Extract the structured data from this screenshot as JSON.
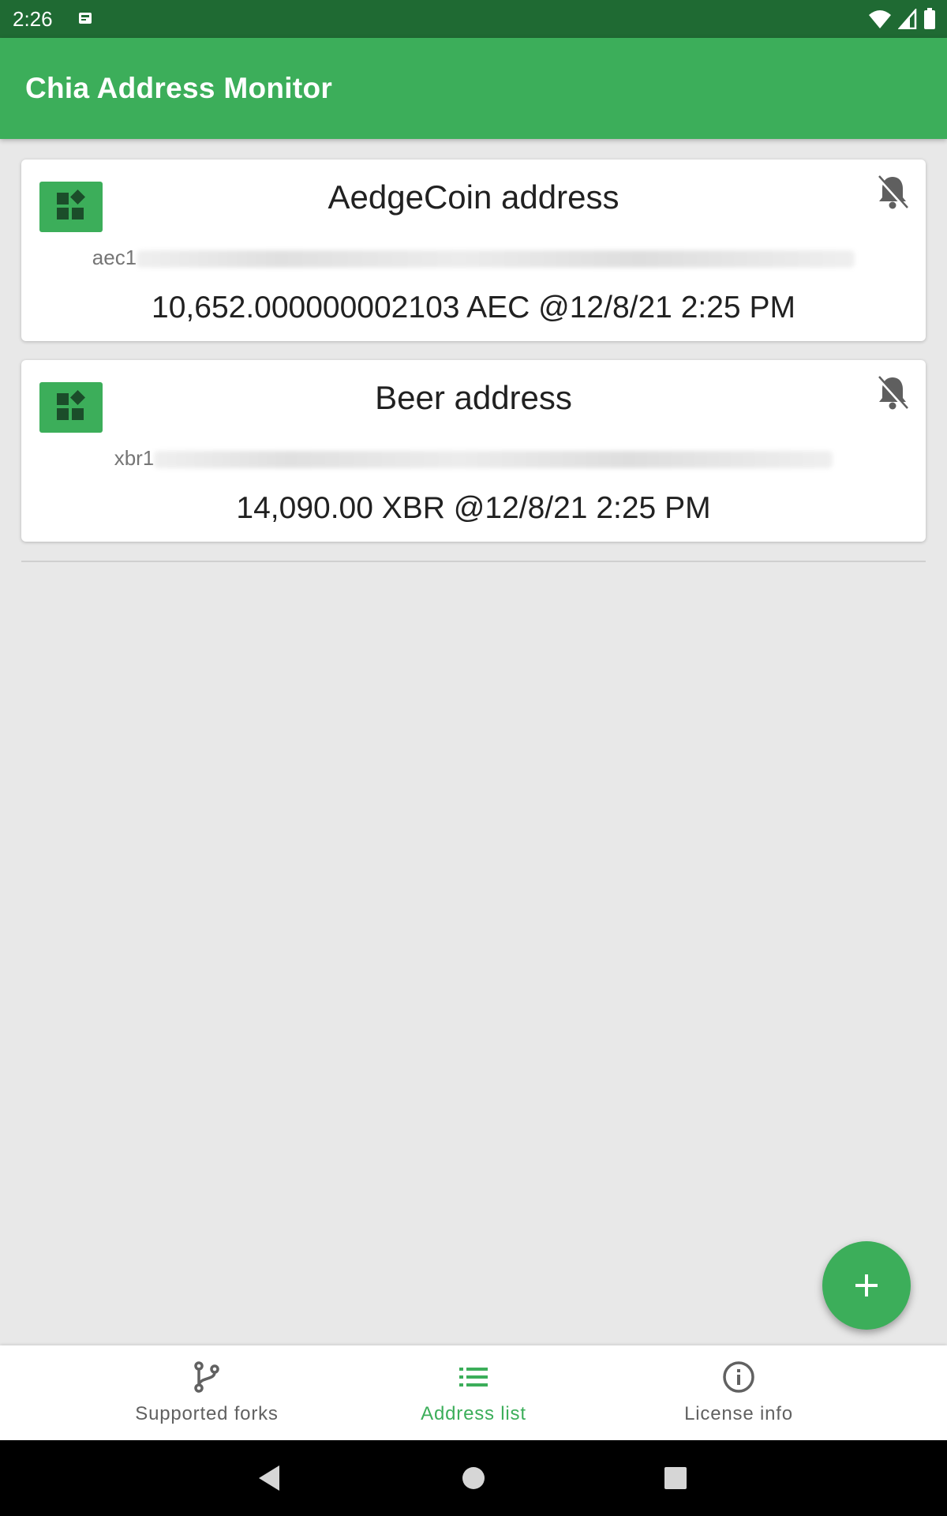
{
  "status_bar": {
    "time": "2:26",
    "icons": [
      "sim-card-notification-icon",
      "wifi-icon",
      "cell-signal-icon",
      "battery-icon"
    ]
  },
  "app_bar": {
    "title": "Chia Address Monitor"
  },
  "addresses": [
    {
      "name": "AedgeCoin address",
      "address_prefix": "aec1",
      "balance": "10,652.000000002103 AEC @12/8/21 2:25 PM",
      "icon": "dashboard-icon",
      "notification_icon": "bell-off-icon"
    },
    {
      "name": "Beer address",
      "address_prefix": "xbr1",
      "balance": "14,090.00 XBR @12/8/21 2:25 PM",
      "icon": "dashboard-icon",
      "notification_icon": "bell-off-icon"
    }
  ],
  "fab": {
    "icon": "plus-icon"
  },
  "bottom_nav": {
    "items": [
      {
        "label": "Supported forks",
        "icon": "fork-icon",
        "active": false
      },
      {
        "label": "Address list",
        "icon": "list-icon",
        "active": true
      },
      {
        "label": "License info",
        "icon": "info-icon",
        "active": false
      }
    ]
  },
  "colors": {
    "primary": "#3cae5a",
    "primary_dark": "#1f6a33",
    "background": "#e8e8e8",
    "card": "#ffffff",
    "text_primary": "#212121",
    "text_secondary": "#757575"
  }
}
